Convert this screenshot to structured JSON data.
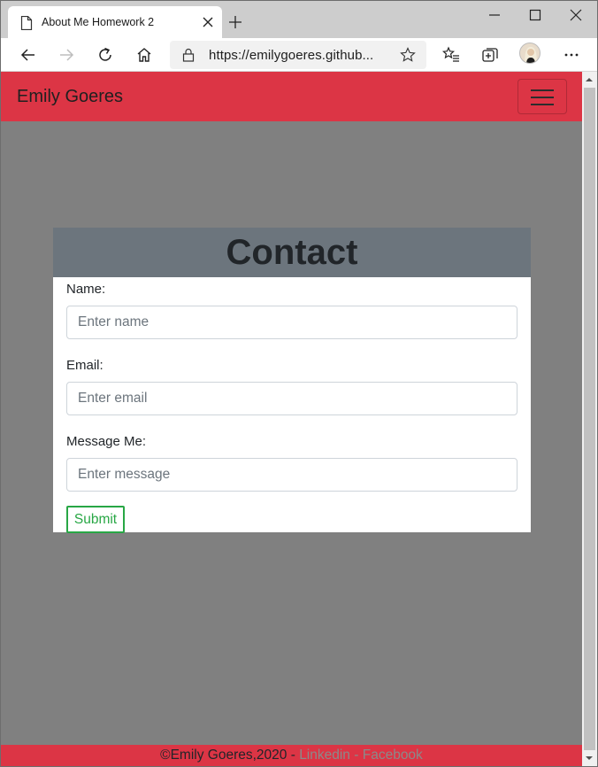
{
  "browser": {
    "tab_title": "About Me Homework 2",
    "url": "https://emilygoeres.github...",
    "icons": [
      "page-icon",
      "close-icon",
      "plus-icon",
      "minimize-icon",
      "maximize-icon",
      "window-close-icon",
      "back-icon",
      "forward-icon",
      "refresh-icon",
      "home-icon",
      "lock-icon",
      "star-icon",
      "favorites-icon",
      "collections-icon",
      "avatar",
      "more-icon"
    ]
  },
  "page": {
    "brand": "Emily Goeres",
    "brand_color": "#dc3545",
    "card": {
      "title": "Contact",
      "name_label": "Name:",
      "name_placeholder": "Enter name",
      "email_label": "Email:",
      "email_placeholder": "Enter email",
      "message_label": "Message Me:",
      "message_placeholder": "Enter message",
      "submit_label": "Submit"
    },
    "footer": {
      "copyright": "©Emily Goeres,2020 -",
      "linkedin": "Linkedin",
      "separator": "-",
      "facebook": "Facebook"
    }
  }
}
